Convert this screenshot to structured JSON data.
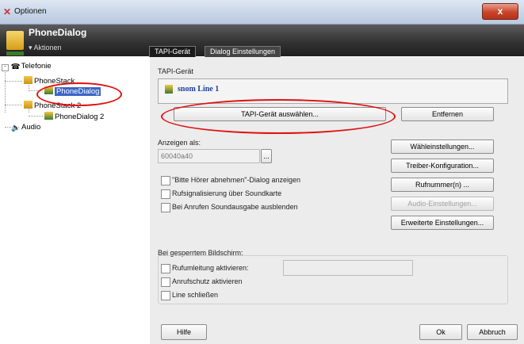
{
  "window": {
    "title": "Optionen",
    "close_label": "x"
  },
  "header": {
    "title": "PhoneDialog",
    "actions": "▾ Aktionen"
  },
  "tabs": [
    {
      "label": "TAPI-Gerät"
    },
    {
      "label": "Dialog Einstellungen"
    }
  ],
  "tree": {
    "telefonie": "Telefonie",
    "phonestack": "PhoneStack",
    "phonedialog": "PhoneDialog",
    "phonestack2": "PhoneStack 2",
    "phonedialog2": "PhoneDialog 2",
    "audio": "Audio"
  },
  "panel": {
    "tapi_group_label": "TAPI-Gerät",
    "tapi_device": "snom Line 1",
    "select_button": "TAPI-Gerät auswählen...",
    "remove_button": "Entfernen",
    "anzeigen_label": "Anzeigen als:",
    "anzeigen_value": "60040a40",
    "browse_button": "...",
    "checkbox1": "\"Bitte Hörer abnehmen\"-Dialog anzeigen",
    "checkbox2": "Rufsignalisierung über Soundkarte",
    "checkbox3": "Bei Anrufen Soundausgabe ausblenden",
    "btn_waehl": "Wähleinstellungen...",
    "btn_treiber": "Treiber-Konfiguration...",
    "btn_rufnummer": "Rufnummer(n) ...",
    "btn_audio": "Audio-Einstellungen...",
    "btn_erweitert": "Erweiterte Einstellungen...",
    "locked_group": "Bei gesperrtem Bildschirm:",
    "locked_cb1": "Rufumleitung aktivieren:",
    "locked_cb2": "Anrufschutz aktivieren",
    "locked_cb3": "Line schließen"
  },
  "footer": {
    "help": "Hilfe",
    "ok": "Ok",
    "cancel": "Abbruch"
  },
  "colors": {
    "selection": "#3a66c8",
    "annotation": "#e01010",
    "header": "#333333"
  }
}
